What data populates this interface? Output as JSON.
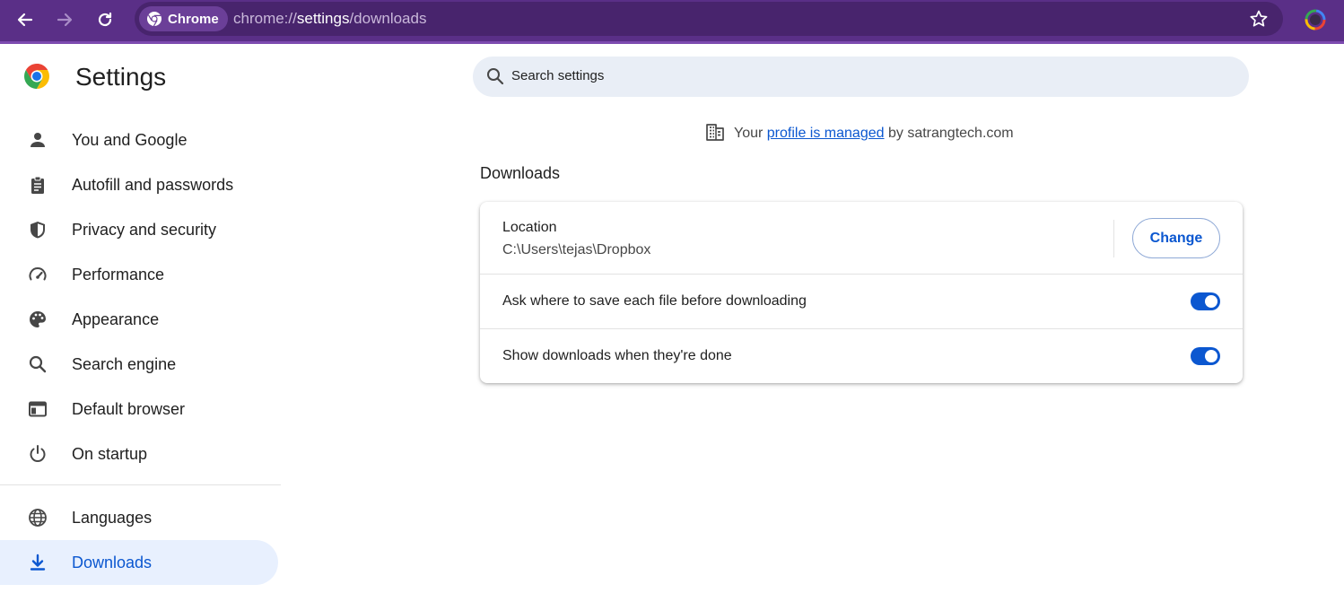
{
  "browser": {
    "chip_label": "Chrome",
    "url_scheme": "chrome://",
    "url_host": "settings",
    "url_path": "/downloads"
  },
  "sidebar": {
    "title": "Settings",
    "items": [
      {
        "label": "You and Google",
        "icon": "person-icon"
      },
      {
        "label": "Autofill and passwords",
        "icon": "clipboard-icon"
      },
      {
        "label": "Privacy and security",
        "icon": "shield-icon"
      },
      {
        "label": "Performance",
        "icon": "speedometer-icon"
      },
      {
        "label": "Appearance",
        "icon": "palette-icon"
      },
      {
        "label": "Search engine",
        "icon": "search-icon"
      },
      {
        "label": "Default browser",
        "icon": "browser-window-icon"
      },
      {
        "label": "On startup",
        "icon": "power-icon"
      },
      {
        "label": "Languages",
        "icon": "globe-icon"
      },
      {
        "label": "Downloads",
        "icon": "download-icon"
      }
    ],
    "active_item": "Downloads"
  },
  "search": {
    "placeholder": "Search settings"
  },
  "managed": {
    "prefix": "Your",
    "link": "profile is managed",
    "suffix": "by satrangtech.com"
  },
  "downloads": {
    "section_title": "Downloads",
    "location_label": "Location",
    "location_path": "C:\\Users\\tejas\\Dropbox",
    "change_button": "Change",
    "ask_where_label": "Ask where to save each file before downloading",
    "ask_where_enabled": true,
    "show_downloads_label": "Show downloads when they're done",
    "show_downloads_enabled": true
  },
  "colors": {
    "toolbar": "#5a2f87",
    "accent": "#0b57d0",
    "active_nav_bg": "#e8f0fe",
    "search_bg": "#e9eef6"
  }
}
